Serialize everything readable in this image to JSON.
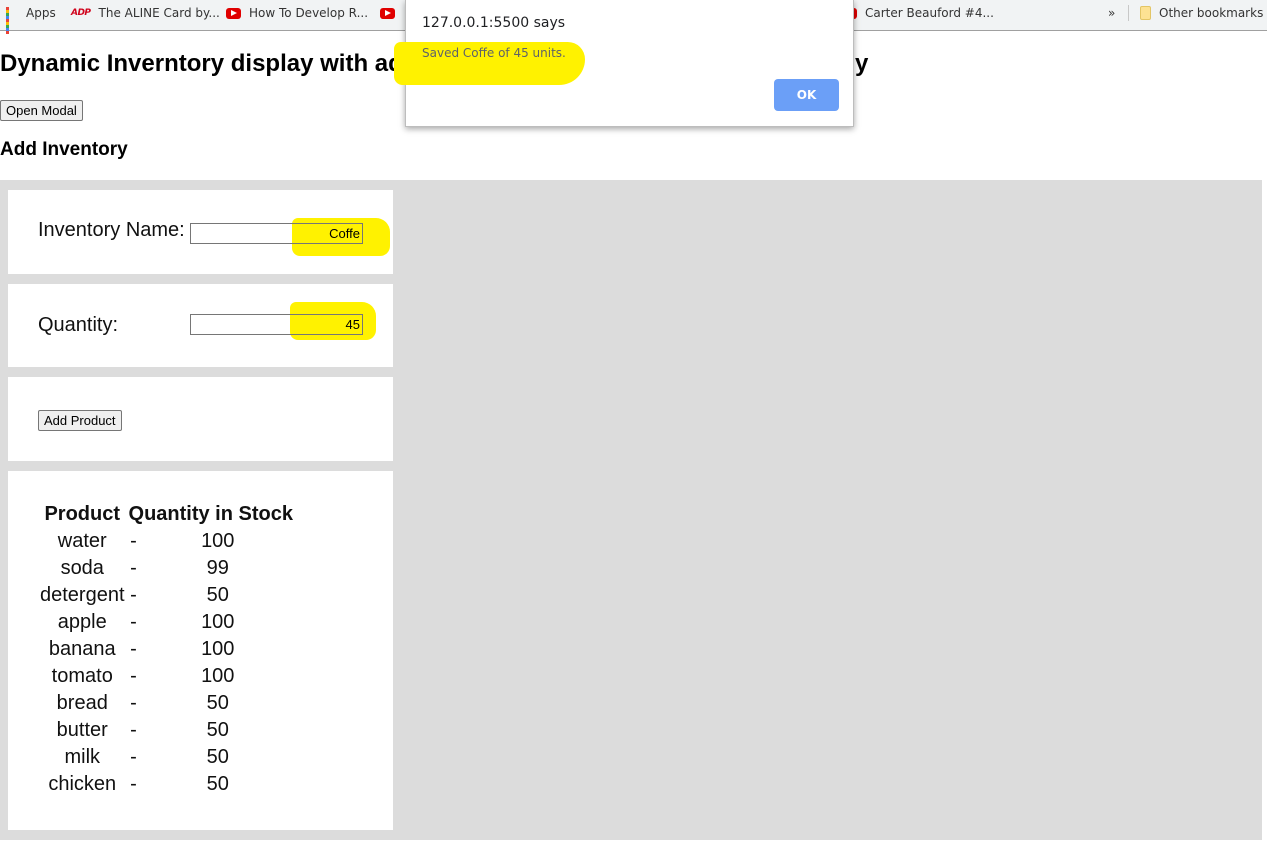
{
  "bookmarks": {
    "apps_label": "Apps",
    "items": [
      "The ALINE Card by...",
      "How To Develop R...",
      "Carter Beauford #4..."
    ],
    "overflow_label": "»",
    "other_label": "Other bookmarks"
  },
  "page": {
    "title": "Dynamic Inverntory display with add",
    "title_end": "y",
    "open_modal_label": "Open Modal",
    "add_heading": "Add Inventory"
  },
  "form": {
    "name_label": "Inventory Name:",
    "name_value": "Coffe",
    "quantity_label": "Quantity:",
    "quantity_value": "45",
    "add_button_label": "Add Product"
  },
  "inventory": {
    "headers": [
      "Product",
      "Quantity in Stock"
    ],
    "separator": "-",
    "rows": [
      {
        "product": "water",
        "qty": "100"
      },
      {
        "product": "soda",
        "qty": "99"
      },
      {
        "product": "detergent",
        "qty": "50"
      },
      {
        "product": "apple",
        "qty": "100"
      },
      {
        "product": "banana",
        "qty": "100"
      },
      {
        "product": "tomato",
        "qty": "100"
      },
      {
        "product": "bread",
        "qty": "50"
      },
      {
        "product": "butter",
        "qty": "50"
      },
      {
        "product": "milk",
        "qty": "50"
      },
      {
        "product": "chicken",
        "qty": "50"
      }
    ]
  },
  "alert": {
    "title": "127.0.0.1:5500 says",
    "message": "Saved Coffe of 45 units.",
    "ok_label": "OK"
  },
  "colors": {
    "highlight": "#fff200",
    "panel_background": "#dcdcdc",
    "ok_button": "#6b9ff7"
  }
}
